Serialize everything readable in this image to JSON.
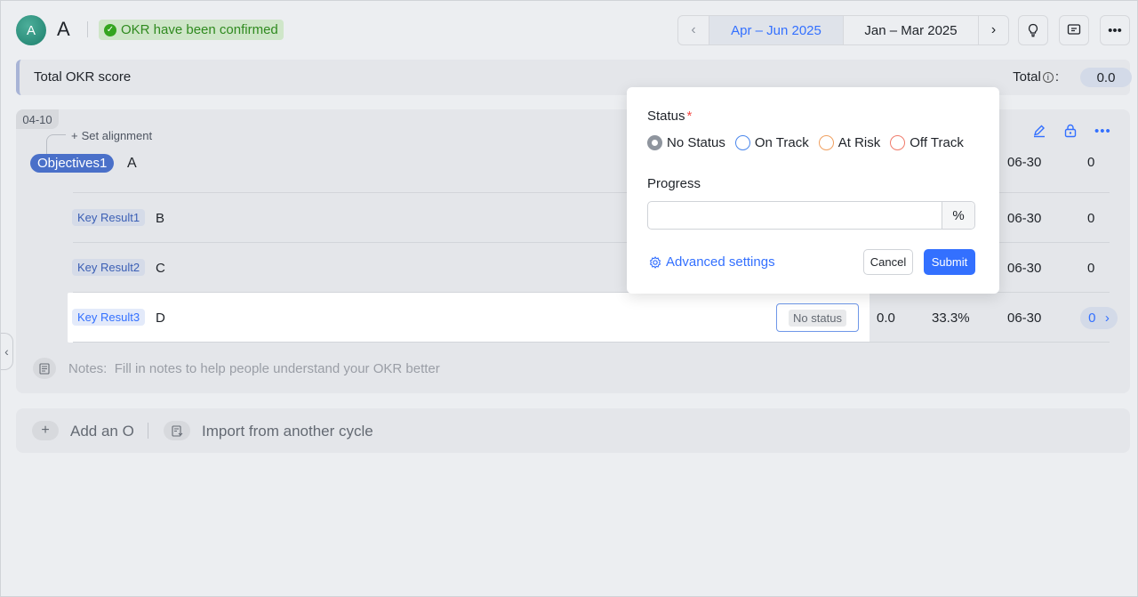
{
  "header": {
    "avatar_initial": "A",
    "user_name": "A",
    "confirm_badge": "OKR have been confirmed",
    "cycle_active": "Apr – Jun 2025",
    "cycle_other": "Jan – Mar 2025"
  },
  "total_bar": {
    "title": "Total OKR score",
    "total_label": "Total",
    "score": "0.0"
  },
  "objective": {
    "date_tag": "04-10",
    "set_alignment": "Set alignment",
    "tag": "Objectives1",
    "name": "A",
    "due": "06-30",
    "count": "0"
  },
  "key_results": [
    {
      "tag": "Key Result1",
      "name": "B",
      "due": "06-30",
      "count": "0"
    },
    {
      "tag": "Key Result2",
      "name": "C",
      "due": "06-30",
      "count": "0"
    },
    {
      "tag": "Key Result3",
      "name": "D",
      "status": "No status",
      "score": "0.0",
      "progress": "33.3%",
      "due": "06-30",
      "count": "0"
    }
  ],
  "notes": {
    "label": "Notes:",
    "placeholder": "Fill in notes to help people understand your OKR better"
  },
  "add_bar": {
    "add_o": "Add an O",
    "import": "Import from another cycle"
  },
  "popup": {
    "status_label": "Status",
    "required_mark": "*",
    "options": [
      "No Status",
      "On Track",
      "At Risk",
      "Off Track"
    ],
    "selected": "No Status",
    "progress_label": "Progress",
    "progress_value": "",
    "percent_symbol": "%",
    "advanced": "Advanced settings",
    "cancel": "Cancel",
    "submit": "Submit"
  },
  "colors": {
    "accent": "#3370ff",
    "confirm_green": "#34a51f",
    "objective_tag": "#4a70c9"
  },
  "icons": [
    "check-circle-icon",
    "chevron-left-icon",
    "chevron-right-icon",
    "bulb-icon",
    "comment-icon",
    "more-icon",
    "info-icon",
    "edit-icon",
    "lock-icon",
    "plus-icon",
    "notes-icon",
    "import-icon",
    "gear-icon"
  ]
}
